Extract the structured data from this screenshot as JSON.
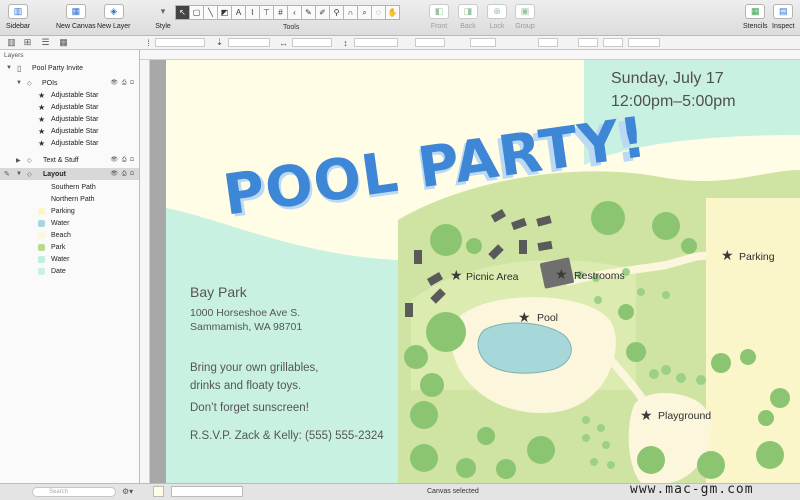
{
  "toolbar": {
    "sidebar": "Sidebar",
    "new_canvas": "New Canvas",
    "new_layer": "New Layer",
    "style": "Style",
    "tools": "Tools",
    "front": "Front",
    "back": "Back",
    "lock": "Lock",
    "group": "Group",
    "stencils": "Stencils",
    "inspect": "Inspect"
  },
  "sidebar": {
    "header": "Layers",
    "canvas_name": "Pool Party Invite",
    "group_pois": "POIs",
    "stars": [
      "Adjustable Star",
      "Adjustable Star",
      "Adjustable Star",
      "Adjustable Star",
      "Adjustable Star"
    ],
    "layer_text": "Text & Stuff",
    "layer_layout": "Layout",
    "layout_items": [
      {
        "label": "Southern Path",
        "color": ""
      },
      {
        "label": "Northern Path",
        "color": ""
      },
      {
        "label": "Parking",
        "color": "#fbf6c9"
      },
      {
        "label": "Water",
        "color": "#a6d8da"
      },
      {
        "label": "Beach",
        "color": "#fbf6dc"
      },
      {
        "label": "Park",
        "color": "#b9d98b"
      },
      {
        "label": "Water",
        "color": "#bfeee4"
      },
      {
        "label": "Date",
        "color": "#c9f1e2"
      }
    ]
  },
  "canvas": {
    "title": "POOL PARTY!",
    "date": "Sunday, July 17",
    "time": "12:00pm–5:00pm",
    "park_name": "Bay Park",
    "address_line1": "1000 Horseshoe Ave S.",
    "address_line2": "Sammamish, WA 98701",
    "bring_line1": "Bring your own grillables,",
    "bring_line2": "drinks and floaty toys.",
    "sunscreen": "Don’t forget sunscreen!",
    "rsvp": "R.S.V.P. Zack & Kelly: (555) 555-2324",
    "labels": {
      "picnic": "Picnic Area",
      "restrooms": "Restrooms",
      "pool": "Pool",
      "parking": "Parking",
      "playground": "Playground"
    }
  },
  "status": {
    "search_placeholder": "Search",
    "message": "Canvas selected",
    "watermark": "www.mac-gm.com"
  },
  "colors": {
    "title_blue": "#3e86d6",
    "mint": "#c9f1e2",
    "park_green": "#cfe4a3",
    "light_green": "#e3efb9",
    "tree_green": "#8cc572",
    "beach": "#fbf6dc",
    "water": "#a6d8da"
  }
}
